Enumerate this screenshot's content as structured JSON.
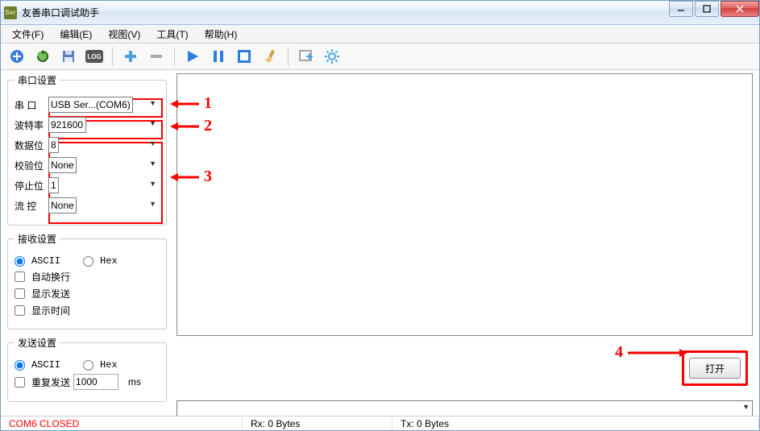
{
  "window": {
    "title": "友善串口调试助手"
  },
  "menu": {
    "file": "文件(F)",
    "edit": "编辑(E)",
    "view": "视图(V)",
    "tools": "工具(T)",
    "help": "帮助(H)"
  },
  "serial_settings": {
    "legend": "串口设置",
    "port_label": "串  口",
    "port_value": "USB Ser...(COM6)",
    "baud_label": "波特率",
    "baud_value": "921600",
    "databits_label": "数据位",
    "databits_value": "8",
    "parity_label": "校验位",
    "parity_value": "None",
    "stopbits_label": "停止位",
    "stopbits_value": "1",
    "flow_label": "流  控",
    "flow_value": "None"
  },
  "recv_settings": {
    "legend": "接收设置",
    "ascii": "ASCII",
    "hex": "Hex",
    "auto_wrap": "自动换行",
    "show_send": "显示发送",
    "show_time": "显示时间"
  },
  "send_settings": {
    "legend": "发送设置",
    "ascii": "ASCII",
    "hex": "Hex",
    "repeat_send": "重复发送",
    "repeat_interval": "1000",
    "repeat_unit": "ms"
  },
  "buttons": {
    "open": "打开"
  },
  "status": {
    "connection": "COM6 CLOSED",
    "rx": "Rx: 0 Bytes",
    "tx": "Tx: 0 Bytes"
  },
  "annotations": {
    "a1": "1",
    "a2": "2",
    "a3": "3",
    "a4": "4"
  }
}
